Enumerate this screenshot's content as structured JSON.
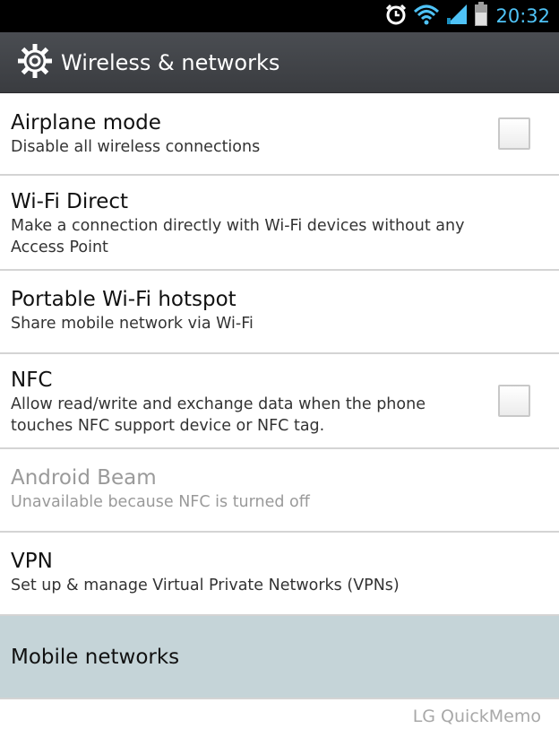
{
  "status_bar": {
    "time": "20:32",
    "icons": [
      "alarm-icon",
      "wifi-icon",
      "signal-icon",
      "battery-icon"
    ]
  },
  "action_bar": {
    "icon": "gear-icon",
    "title": "Wireless & networks"
  },
  "settings": [
    {
      "title": "Airplane mode",
      "summary": "Disable all wireless connections",
      "checkbox": true,
      "checked": false,
      "enabled": true
    },
    {
      "title": "Wi-Fi Direct",
      "summary": "Make a connection directly with Wi-Fi devices without any Access Point",
      "checkbox": false,
      "enabled": true
    },
    {
      "title": "Portable Wi-Fi hotspot",
      "summary": "Share mobile network via Wi-Fi",
      "checkbox": false,
      "enabled": true
    },
    {
      "title": "NFC",
      "summary": "Allow read/write and exchange data when the phone touches NFC support device or NFC tag.",
      "checkbox": true,
      "checked": false,
      "enabled": true
    },
    {
      "title": "Android Beam",
      "summary": "Unavailable because NFC is turned off",
      "checkbox": false,
      "enabled": false
    },
    {
      "title": "VPN",
      "summary": "Set up & manage Virtual Private Networks (VPNs)",
      "checkbox": false,
      "enabled": true
    },
    {
      "title": "Mobile networks",
      "summary": "",
      "checkbox": false,
      "enabled": true,
      "highlighted": true
    }
  ],
  "watermark": "LG QuickMemo",
  "colors": {
    "status_time": "#4fc3f7",
    "action_bar": "#404246",
    "highlight": "#c5d4d8",
    "divider": "#d4d4d4",
    "disabled_text": "#9a9a9a"
  }
}
